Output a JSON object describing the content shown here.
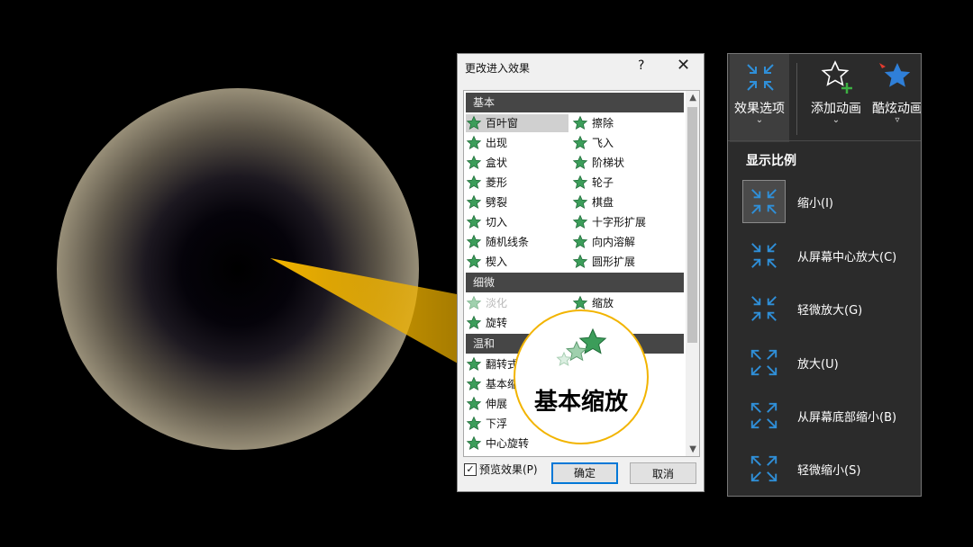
{
  "dialog": {
    "title": "更改进入效果",
    "help": "?",
    "close": "✕",
    "groups": [
      "基本",
      "细微",
      "温和"
    ],
    "basic_items_left": [
      "百叶窗",
      "出现",
      "盒状",
      "菱形",
      "劈裂",
      "切入",
      "随机线条",
      "楔入"
    ],
    "basic_items_right": [
      "擦除",
      "飞入",
      "阶梯状",
      "轮子",
      "棋盘",
      "十字形扩展",
      "向内溶解",
      "圆形扩展"
    ],
    "subtle_items_left": [
      "淡化",
      "旋转"
    ],
    "subtle_items_right": [
      "缩放"
    ],
    "moderate_items_left": [
      "翻转式",
      "基本缩",
      "伸展",
      "下浮",
      "中心旋转"
    ],
    "preview_checked": "✓",
    "preview_label": "预览效果(P)",
    "ok": "确定",
    "cancel": "取消"
  },
  "callout": {
    "text": "基本缩放"
  },
  "ribbon": {
    "effect_options": "效果选项",
    "add_animation": "添加动画",
    "cool_animation": "酷炫动画",
    "caret": "⌄",
    "caret2": "▿"
  },
  "menu": {
    "heading": "显示比例",
    "items": [
      "缩小(I)",
      "从屏幕中心放大(C)",
      "轻微放大(G)",
      "放大(U)",
      "从屏幕底部缩小(B)",
      "轻微缩小(S)"
    ]
  },
  "colors": {
    "accent_blue": "#2f8fd8",
    "star_green": "#3c9d5a",
    "beam_yellow": "#f2b400"
  }
}
